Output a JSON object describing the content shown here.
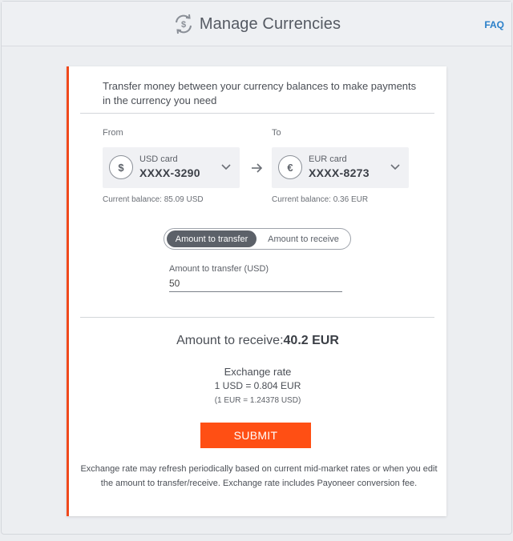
{
  "header": {
    "title": "Manage Currencies",
    "faq_label": "FAQ"
  },
  "intro_text": "Transfer money between your currency balances to make payments in the currency you need",
  "from": {
    "label": "From",
    "symbol": "$",
    "card_name": "USD card",
    "card_number": "XXXX-3290",
    "balance": "Current balance: 85.09 USD"
  },
  "to": {
    "label": "To",
    "symbol": "€",
    "card_name": "EUR card",
    "card_number": "XXXX-8273",
    "balance": "Current balance: 0.36 EUR"
  },
  "toggle": {
    "active": "Amount to transfer",
    "inactive": "Amount to receive"
  },
  "amount": {
    "label": "Amount to transfer (USD)",
    "value": "50"
  },
  "receive": {
    "label": "Amount to receive:",
    "value": "40.2 EUR"
  },
  "rate": {
    "title": "Exchange rate",
    "value": "1 USD = 0.804 EUR",
    "inverse": "(1 EUR = 1.24378 USD)"
  },
  "submit_label": "SUBMIT",
  "disclaimer": "Exchange rate may refresh periodically based on current mid-market rates or when you edit the amount to transfer/receive. Exchange rate includes Payoneer conversion fee.",
  "colors": {
    "accent": "#ff4f14",
    "link": "#2a7fc9",
    "toggle_active": "#5c6169"
  },
  "icons": [
    "currency-exchange-icon",
    "chevron-down-icon",
    "arrow-right-icon"
  ]
}
